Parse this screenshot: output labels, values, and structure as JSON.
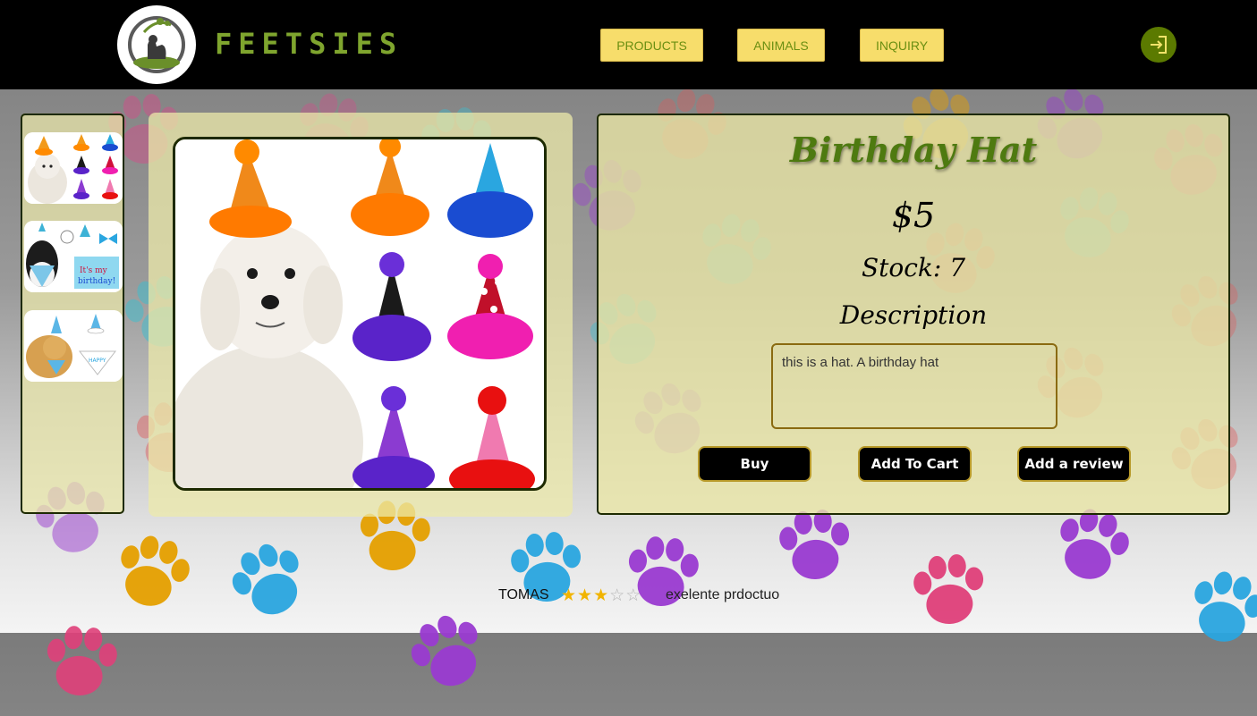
{
  "header": {
    "brand": "FEETSIES",
    "nav": [
      {
        "label": "PRODUCTS"
      },
      {
        "label": "ANIMALS"
      },
      {
        "label": "INQUIRY"
      }
    ],
    "login_icon": "login-icon"
  },
  "colors": {
    "brand_green": "#7fa52e",
    "nav_button": "#f7dd6b",
    "panel_bg": "#eae7a5",
    "title_green": "#4e7a10",
    "login_button": "#5b7a00"
  },
  "gallery": {
    "thumbnails": [
      {
        "alt": "dog with party hats"
      },
      {
        "alt": "dog with birthday bandana"
      },
      {
        "alt": "golden retriever with birthday hat"
      }
    ]
  },
  "product": {
    "title": "Birthday Hat",
    "price": "$5",
    "stock_label": "Stock:",
    "stock_value": "7",
    "description_heading": "Description",
    "description": "this is a hat. A birthday hat"
  },
  "actions": {
    "buy": "Buy",
    "add_to_cart": "Add To Cart",
    "add_review": "Add a review"
  },
  "reviews": [
    {
      "author": "TOMAS",
      "rating": 3,
      "max_rating": 5,
      "text": "exelente prdoctuo"
    }
  ]
}
